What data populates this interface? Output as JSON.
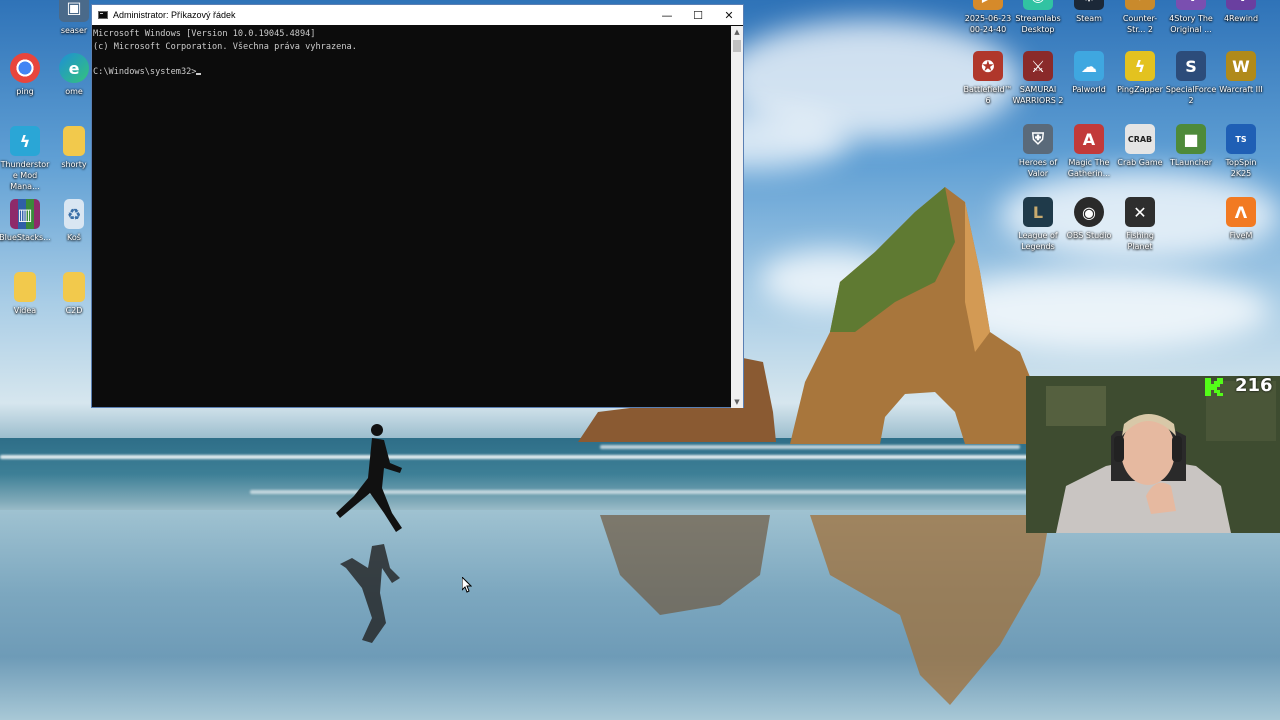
{
  "window": {
    "title": "Administrator: Příkazový řádek",
    "minimize_glyph": "—",
    "maximize_glyph": "☐",
    "close_glyph": "✕",
    "lines": [
      "Microsoft Windows [Version 10.0.19045.4894]",
      "(c) Microsoft Corporation. Všechna práva vyhrazena.",
      "",
      "C:\\Windows\\system32>"
    ]
  },
  "desktop_left": [
    {
      "label": "seaser",
      "icon": "app-icon",
      "color": "#4a6a8a"
    },
    {
      "label": "ping",
      "icon": "chrome-icon",
      "color": "#e8453c"
    },
    {
      "label": "ome",
      "icon": "edge-icon",
      "color": "#1e8fd6"
    },
    {
      "label": "Thunderstore Mod Mana...",
      "icon": "thunderstore-icon",
      "color": "#2aa6d6"
    },
    {
      "label": "shorty",
      "icon": "folder-icon",
      "color": "#f2c94c"
    },
    {
      "label": "BlueStacks...",
      "icon": "winrar-icon",
      "color": "#8e2a6a"
    },
    {
      "label": "Koš",
      "icon": "recycle-bin-icon",
      "color": "#d9e6f2"
    },
    {
      "label": "Videa",
      "icon": "folder-icon",
      "color": "#f2c94c"
    },
    {
      "label": "C2D",
      "icon": "folder-icon",
      "color": "#f2c94c"
    }
  ],
  "desktop_right": [
    {
      "label": "2025-06-23 00-24-40",
      "icon": "video-file-icon",
      "color": "#d68a2a"
    },
    {
      "label": "Streamlabs Desktop",
      "icon": "streamlabs-icon",
      "color": "#31c3a2"
    },
    {
      "label": "Steam",
      "icon": "steam-icon",
      "color": "#1b2838"
    },
    {
      "label": "Counter-Str... 2",
      "icon": "cs2-icon",
      "color": "#c98a2c"
    },
    {
      "label": "4Story The Original ...",
      "icon": "4story-icon",
      "color": "#7a4fb0"
    },
    {
      "label": "4Rewind",
      "icon": "4rewind-icon",
      "color": "#6a3fa0"
    },
    {
      "label": "Battlefield™ 6",
      "icon": "battlefield-icon",
      "color": "#b0372b"
    },
    {
      "label": "SAMURAI WARRIORS 2",
      "icon": "samurai-warriors-icon",
      "color": "#8a2a2a"
    },
    {
      "label": "Palworld",
      "icon": "palworld-icon",
      "color": "#3fa7e0"
    },
    {
      "label": "PingZapper",
      "icon": "pingzapper-icon",
      "color": "#e3c21f"
    },
    {
      "label": "SpecialForce2",
      "icon": "specialforce-icon",
      "color": "#2c4c7a"
    },
    {
      "label": "Warcraft III",
      "icon": "warcraft-icon",
      "color": "#b08a1a"
    },
    {
      "label": "Heroes of Valor",
      "icon": "heroes-of-valor-icon",
      "color": "#5a6a7a"
    },
    {
      "label": "Magic The Gatherin...",
      "icon": "magic-gathering-icon",
      "color": "#c23a3a"
    },
    {
      "label": "Crab Game",
      "icon": "crab-game-icon",
      "color": "#e5e5e5"
    },
    {
      "label": "TLauncher",
      "icon": "tlauncher-icon",
      "color": "#4e8a3a"
    },
    {
      "label": "TopSpin 2K25",
      "icon": "topspin-icon",
      "color": "#1f5fb5"
    },
    {
      "label": "League of Legends",
      "icon": "league-icon",
      "color": "#1f3a4a"
    },
    {
      "label": "OBS Studio",
      "icon": "obs-icon",
      "color": "#2a2a2a"
    },
    {
      "label": "Fishing Planet",
      "icon": "fishing-planet-icon",
      "color": "#2e2e2e"
    },
    {
      "label": "FiveM",
      "icon": "fivem-icon",
      "color": "#f27a22"
    }
  ],
  "stream": {
    "viewer_count": "216",
    "kick_color": "#53fc18"
  }
}
